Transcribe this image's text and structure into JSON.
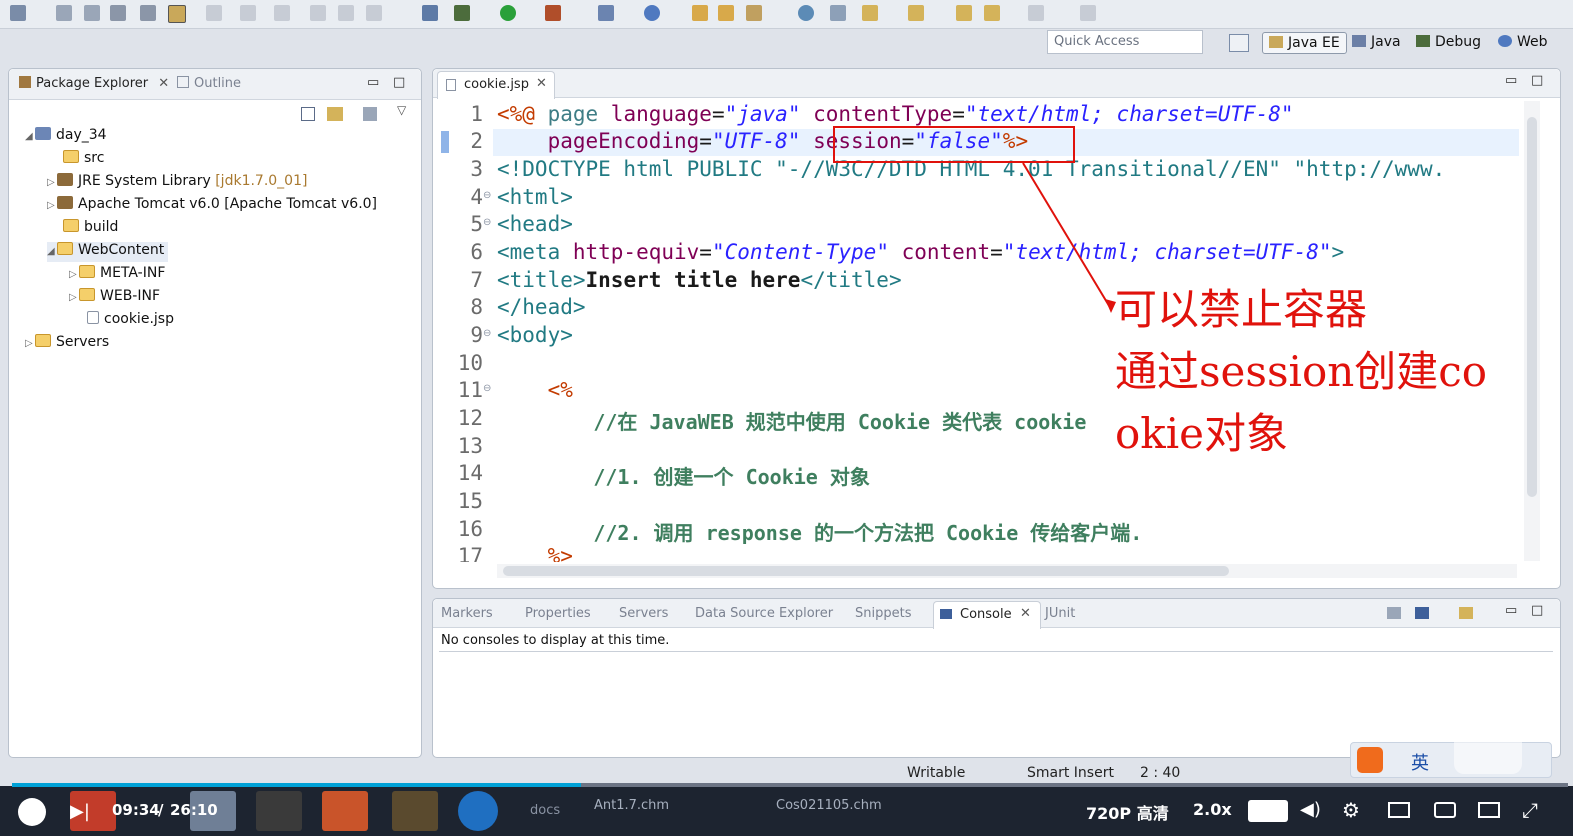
{
  "toolbar": {
    "quick_access_placeholder": "Quick Access"
  },
  "perspectives": [
    "Java EE",
    "Java",
    "Debug",
    "Web"
  ],
  "left_panel": {
    "tabs": [
      "Package Explorer",
      "Outline"
    ],
    "tree": [
      {
        "label": "day_34"
      },
      {
        "label": "src"
      },
      {
        "label": "JRE System Library",
        "decoration": "[jdk1.7.0_01]"
      },
      {
        "label": "Apache Tomcat v6.0 [Apache Tomcat v6.0]"
      },
      {
        "label": "build"
      },
      {
        "label": "WebContent"
      },
      {
        "label": "META-INF"
      },
      {
        "label": "WEB-INF"
      },
      {
        "label": "cookie.jsp"
      },
      {
        "label": "Servers"
      }
    ]
  },
  "editor": {
    "tab": "cookie.jsp",
    "line_numbers": [
      "1",
      "2",
      "3",
      "4",
      "5",
      "6",
      "7",
      "8",
      "9",
      "10",
      "11",
      "12",
      "13",
      "14",
      "15",
      "16",
      "17"
    ],
    "lines": {
      "l1": {
        "a": "<%@",
        "b": " page ",
        "c": "language",
        "d": "=",
        "e": "\"java\"",
        "f": " contentType",
        "g": "=",
        "h": "\"text/html; charset=UTF-8\""
      },
      "l2": {
        "a": "    pageEncoding",
        "b": "=",
        "c": "\"UTF-8\"",
        "d": " session",
        "e": "=",
        "f": "\"false\"",
        "g": "%>"
      },
      "l3": "<!DOCTYPE html PUBLIC \"-//W3C//DTD HTML 4.01 Transitional//EN\" \"http://www.",
      "l4": "<html>",
      "l5": "<head>",
      "l6": {
        "a": "<meta",
        "b": " http-equiv",
        "c": "=",
        "d": "\"Content-Type\"",
        "e": " content",
        "f": "=",
        "g": "\"text/html; charset=UTF-8\"",
        "h": ">"
      },
      "l7": {
        "a": "<title>",
        "b": "Insert title here",
        "c": "</title>"
      },
      "l8": "</head>",
      "l9": "<body>",
      "l11": "    <%",
      "l12": "        //在 JavaWEB 规范中使用 Cookie 类代表 cookie",
      "l14": "        //1. 创建一个 Cookie 对象",
      "l16": "        //2. 调用 response 的一个方法把 Cookie 传给客户端.",
      "l17": "    %>"
    },
    "annotation": "可以禁止容器\n通过session创建co\nokie对象"
  },
  "bottom_panel": {
    "tabs": [
      "Markers",
      "Properties",
      "Servers",
      "Data Source Explorer",
      "Snippets",
      "Console",
      "JUnit"
    ],
    "message": "No consoles to display at this time."
  },
  "status_bar": {
    "writable": "Writable",
    "insert_mode": "Smart Insert",
    "position": "2 : 40"
  },
  "ime": {
    "lang": "英"
  },
  "video": {
    "current_time": "09:34",
    "sep": "/",
    "duration": "26:10",
    "played_fraction": 0.366,
    "quality": "720P 高清",
    "speed": "2.0x",
    "taskbar_items": [
      "docs",
      "Ant1.7.chm",
      "Cos021105.chm"
    ]
  },
  "colors": {
    "annotation": "#e0120c",
    "progress": "#00a1d6"
  }
}
